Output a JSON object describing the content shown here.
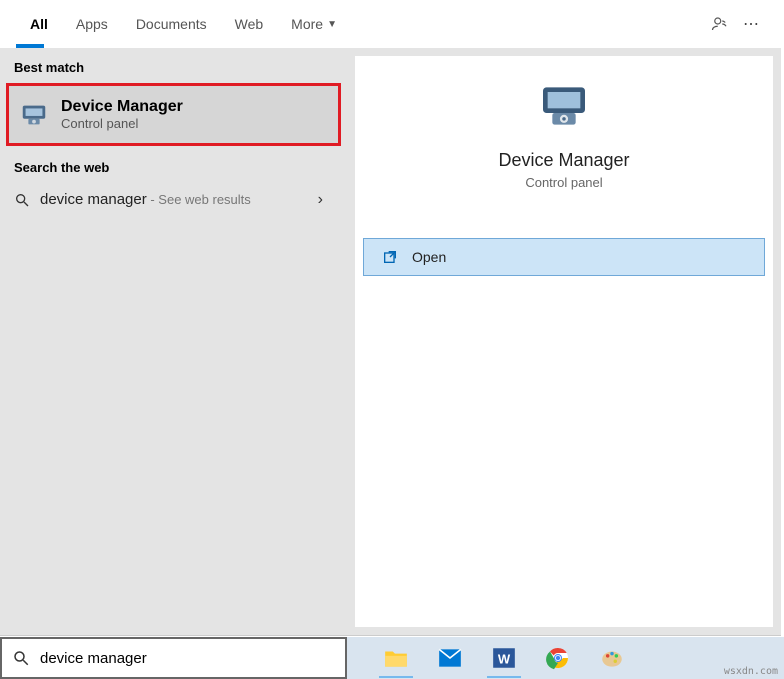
{
  "tabs": {
    "all": "All",
    "apps": "Apps",
    "documents": "Documents",
    "web": "Web",
    "more": "More"
  },
  "sections": {
    "best_match": "Best match",
    "search_web": "Search the web"
  },
  "best_match": {
    "title": "Device Manager",
    "subtitle": "Control panel"
  },
  "web_result": {
    "query": "device manager",
    "hint": " - See web results"
  },
  "preview": {
    "title": "Device Manager",
    "subtitle": "Control panel"
  },
  "actions": {
    "open": "Open"
  },
  "search": {
    "value": "device manager"
  },
  "watermark": "wsxdn.com"
}
